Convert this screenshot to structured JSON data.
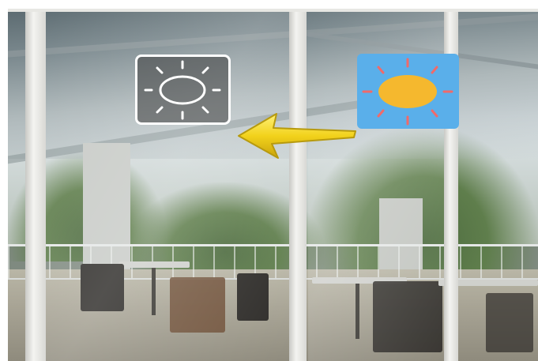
{
  "scene": {
    "description_tag": "glass-facade-terrace"
  },
  "icons": {
    "dim_sun": {
      "name": "dim-sun-icon",
      "frame_color": "#ffffff",
      "fill": "rgba(60,60,60,0.55)"
    },
    "bright_sun": {
      "name": "bright-sun-icon",
      "box_color": "#5aafea",
      "sun_color": "#f5b82e",
      "ray_color": "#f06a6a"
    },
    "arrow": {
      "name": "arrow-left-icon",
      "color": "#f2d21b",
      "outline": "#b79a0e"
    }
  }
}
